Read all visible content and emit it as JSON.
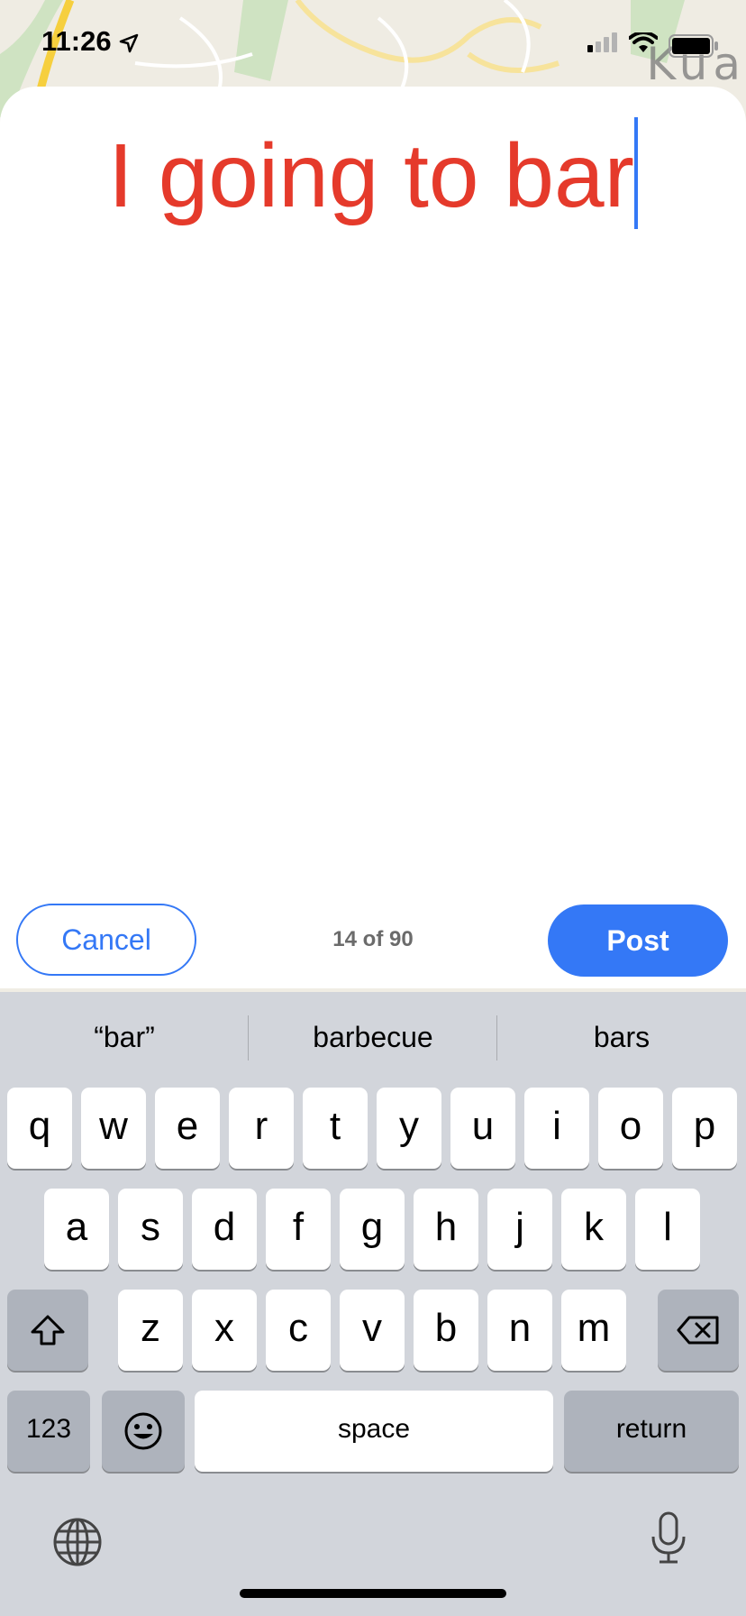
{
  "status_bar": {
    "time": "11:26",
    "icons": [
      "location-arrow-icon",
      "cellular-signal-icon",
      "wifi-icon",
      "battery-icon"
    ]
  },
  "map": {
    "label": "Kua"
  },
  "compose": {
    "text": "I going to bar",
    "text_color": "#e53a2b",
    "caret_color": "#3478f6"
  },
  "actions": {
    "cancel_label": "Cancel",
    "counter": "14 of 90",
    "post_label": "Post",
    "accent_color": "#3478f6"
  },
  "keyboard": {
    "suggestions": [
      "“bar”",
      "barbecue",
      "bars"
    ],
    "row1": [
      "q",
      "w",
      "e",
      "r",
      "t",
      "y",
      "u",
      "i",
      "o",
      "p"
    ],
    "row2": [
      "a",
      "s",
      "d",
      "f",
      "g",
      "h",
      "j",
      "k",
      "l"
    ],
    "row3": [
      "z",
      "x",
      "c",
      "v",
      "b",
      "n",
      "m"
    ],
    "numbers_label": "123",
    "space_label": "space",
    "return_label": "return",
    "icons": [
      "shift-icon",
      "backspace-icon",
      "emoji-icon",
      "globe-icon",
      "microphone-icon"
    ]
  }
}
